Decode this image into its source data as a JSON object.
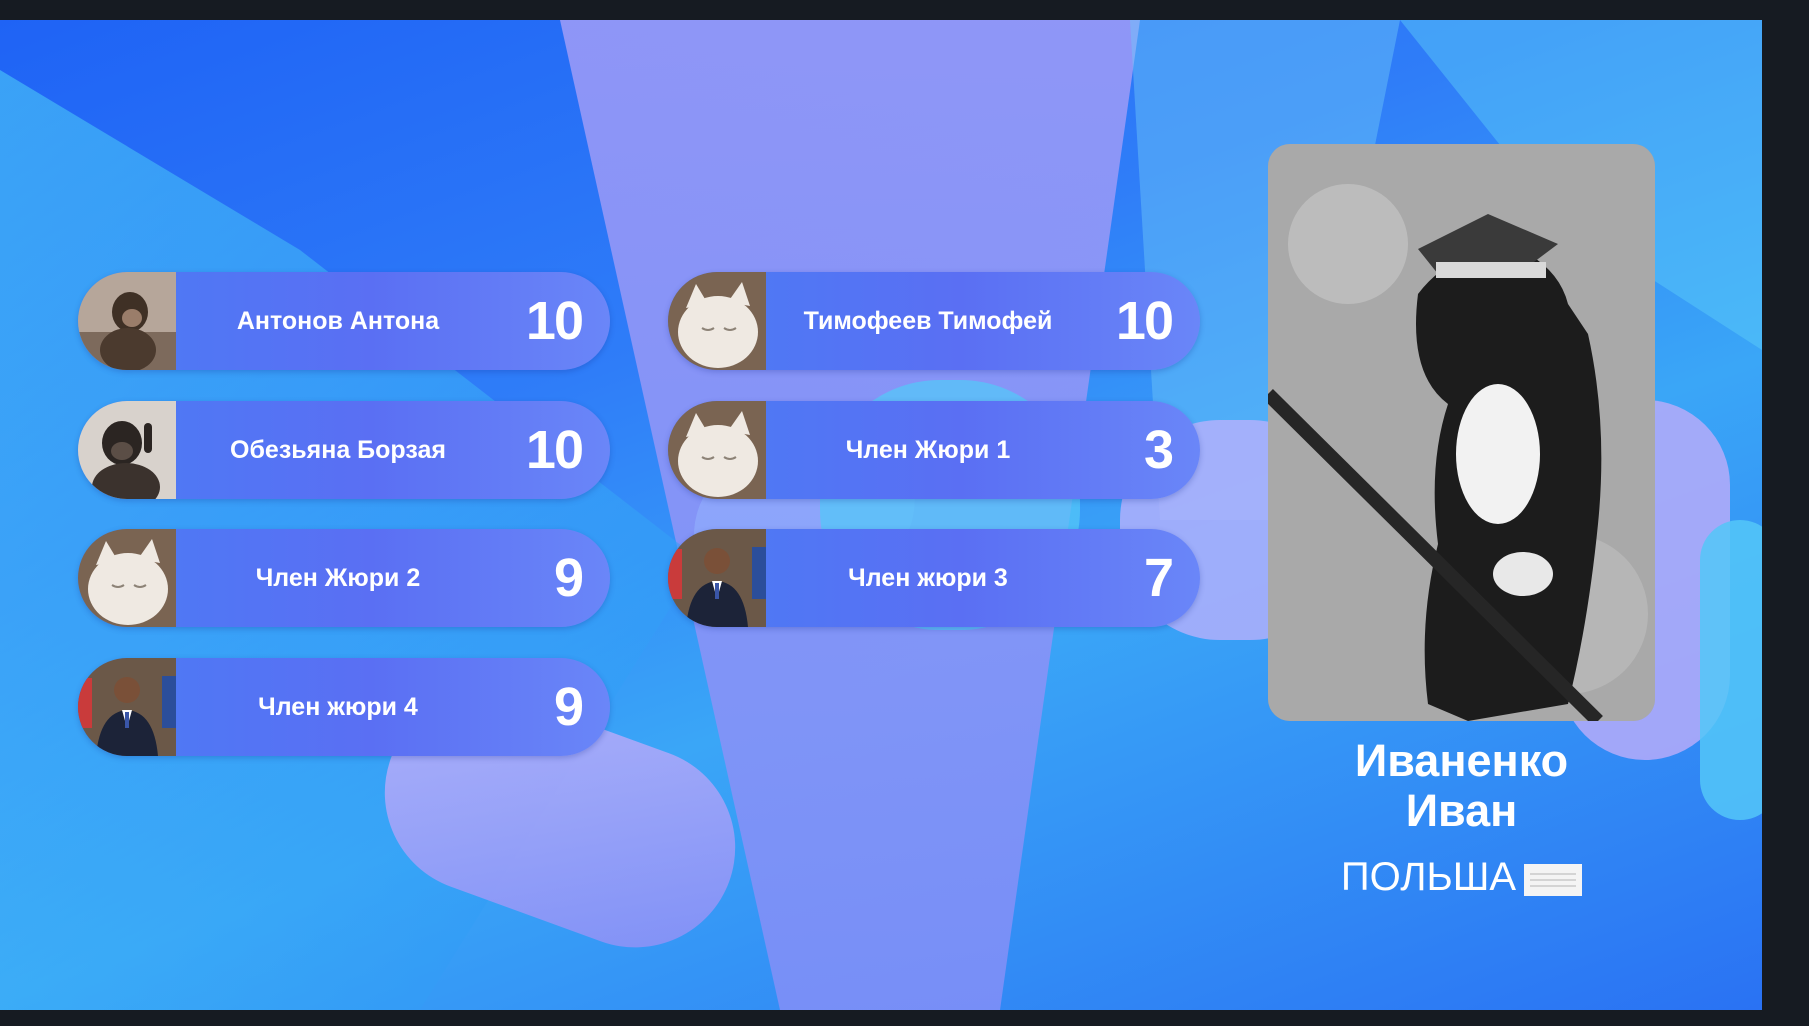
{
  "jury": [
    {
      "name": "Антонов Антона",
      "score": "10",
      "avatar": "chimp-icon"
    },
    {
      "name": "Обезьяна Борзая",
      "score": "10",
      "avatar": "gorilla-icon"
    },
    {
      "name": "Член Жюри 2",
      "score": "9",
      "avatar": "cat-icon"
    },
    {
      "name": "Член жюри 4",
      "score": "9",
      "avatar": "person-icon"
    },
    {
      "name": "Тимофеев Тимофей",
      "score": "10",
      "avatar": "cat-icon"
    },
    {
      "name": "Член Жюри 1",
      "score": "3",
      "avatar": "cat-icon"
    },
    {
      "name": "Член жюри 3",
      "score": "7",
      "avatar": "person-icon"
    }
  ],
  "contestant": {
    "first_line": "Иваненко",
    "second_line": "Иван",
    "country": "ПОЛЬША",
    "flag_icon": "flag-icon",
    "photo_icon": "cat-soldier-photo"
  },
  "colors": {
    "background": "#2f7df8",
    "row": "#5a6ff3",
    "text": "#ffffff"
  }
}
